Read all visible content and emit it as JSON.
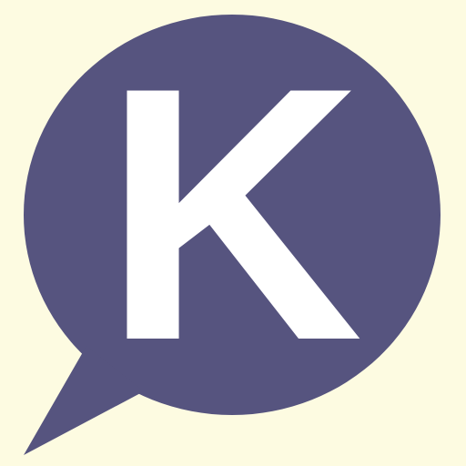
{
  "icon": {
    "name": "speech-bubble-icon",
    "letter": "K"
  },
  "colors": {
    "background": "#fdfbe1",
    "bubble": "#56547f",
    "letter": "#ffffff"
  }
}
